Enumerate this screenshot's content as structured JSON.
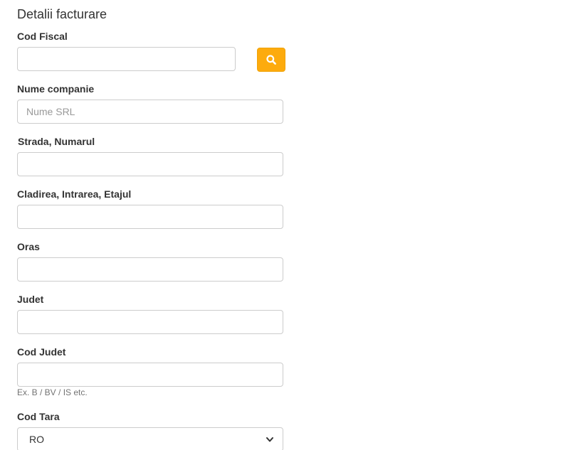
{
  "form": {
    "title": "Detalii facturare",
    "cod_fiscal": {
      "label": "Cod Fiscal",
      "value": "",
      "placeholder": ""
    },
    "search_button": {
      "icon": "search-icon",
      "color": "#fdab0d"
    },
    "nume_companie": {
      "label": "Nume companie",
      "value": "",
      "placeholder": "Nume SRL"
    },
    "strada": {
      "label": "Strada, Numarul",
      "value": "",
      "placeholder": ""
    },
    "cladirea": {
      "label": "Cladirea, Intrarea, Etajul",
      "value": "",
      "placeholder": ""
    },
    "oras": {
      "label": "Oras",
      "value": "",
      "placeholder": ""
    },
    "judet": {
      "label": "Judet",
      "value": "",
      "placeholder": ""
    },
    "cod_judet": {
      "label": "Cod Judet",
      "value": "",
      "placeholder": "",
      "help": "Ex. B / BV / IS etc."
    },
    "cod_tara": {
      "label": "Cod Tara",
      "selected": "RO",
      "icon": "chevron-down-icon"
    }
  }
}
